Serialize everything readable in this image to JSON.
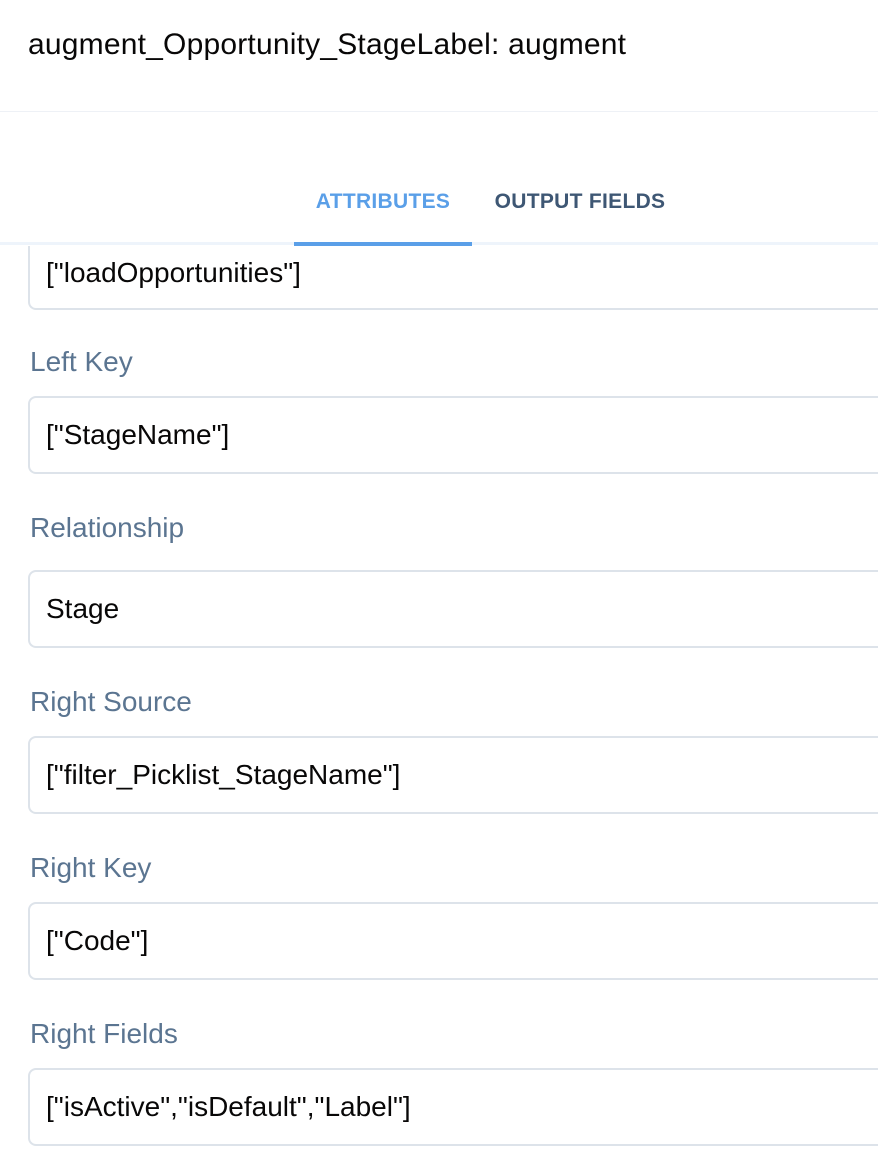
{
  "header": {
    "title": "augment_Opportunity_StageLabel: augment"
  },
  "tabs": [
    {
      "label": "ATTRIBUTES",
      "active": true
    },
    {
      "label": "OUTPUT FIELDS",
      "active": false
    }
  ],
  "colors": {
    "accent": "#5a9fe8",
    "label": "#5b7591",
    "tab_inactive": "#3e5774",
    "border": "#dde3ea"
  },
  "fields": {
    "left_source": {
      "value": "[\"loadOpportunities\"]"
    },
    "left_key": {
      "label": "Left Key",
      "value": "[\"StageName\"]"
    },
    "relationship": {
      "label": "Relationship",
      "value": "Stage"
    },
    "right_source": {
      "label": "Right Source",
      "value": "[\"filter_Picklist_StageName\"]"
    },
    "right_key": {
      "label": "Right Key",
      "value": "[\"Code\"]"
    },
    "right_fields": {
      "label": "Right Fields",
      "value": "[\"isActive\",\"isDefault\",\"Label\"]"
    }
  }
}
